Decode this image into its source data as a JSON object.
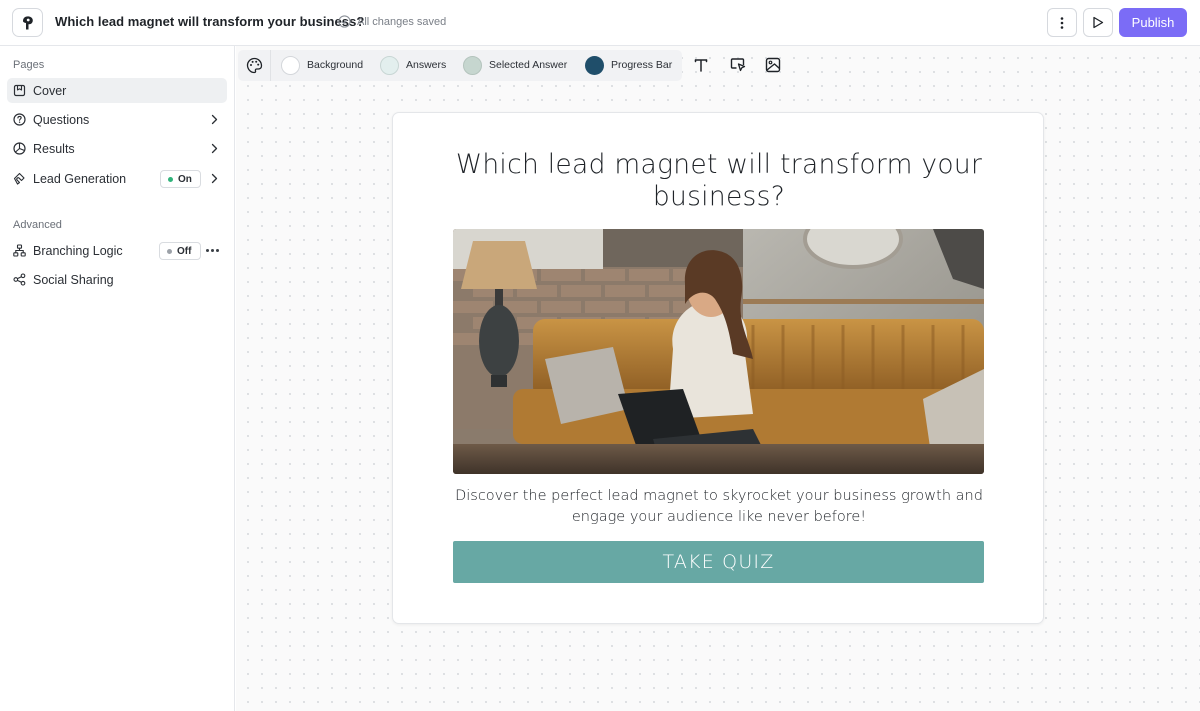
{
  "header": {
    "title": "Which lead magnet will transform your business?",
    "save_status": "All changes saved",
    "publish_label": "Publish"
  },
  "sidebar": {
    "pages_label": "Pages",
    "pages": [
      {
        "label": "Cover",
        "icon": "page-icon",
        "active": true
      },
      {
        "label": "Questions",
        "icon": "question-icon"
      },
      {
        "label": "Results",
        "icon": "results-icon"
      },
      {
        "label": "Lead Generation",
        "icon": "magnet-icon",
        "status": "On"
      }
    ],
    "advanced_label": "Advanced",
    "advanced": [
      {
        "label": "Branching Logic",
        "icon": "branch-icon",
        "status": "Off"
      },
      {
        "label": "Social Sharing",
        "icon": "share-icon"
      }
    ]
  },
  "theme_bar": {
    "swatches": [
      {
        "label": "Background",
        "color": "#ffffff"
      },
      {
        "label": "Answers",
        "color": "#e3efee"
      },
      {
        "label": "Selected Answer",
        "color": "#c6d6cf"
      },
      {
        "label": "Progress Bar",
        "color": "#1f4e6a"
      }
    ],
    "tools": [
      "palette-icon",
      "text-icon",
      "button-style-icon",
      "image-icon"
    ]
  },
  "quiz": {
    "title": "Which lead magnet will transform your business?",
    "description": "Discover the perfect lead magnet to skyrocket your business growth and engage your audience like never before!",
    "cta_label": "TAKE QUIZ",
    "cta_color": "#67a8a4"
  }
}
